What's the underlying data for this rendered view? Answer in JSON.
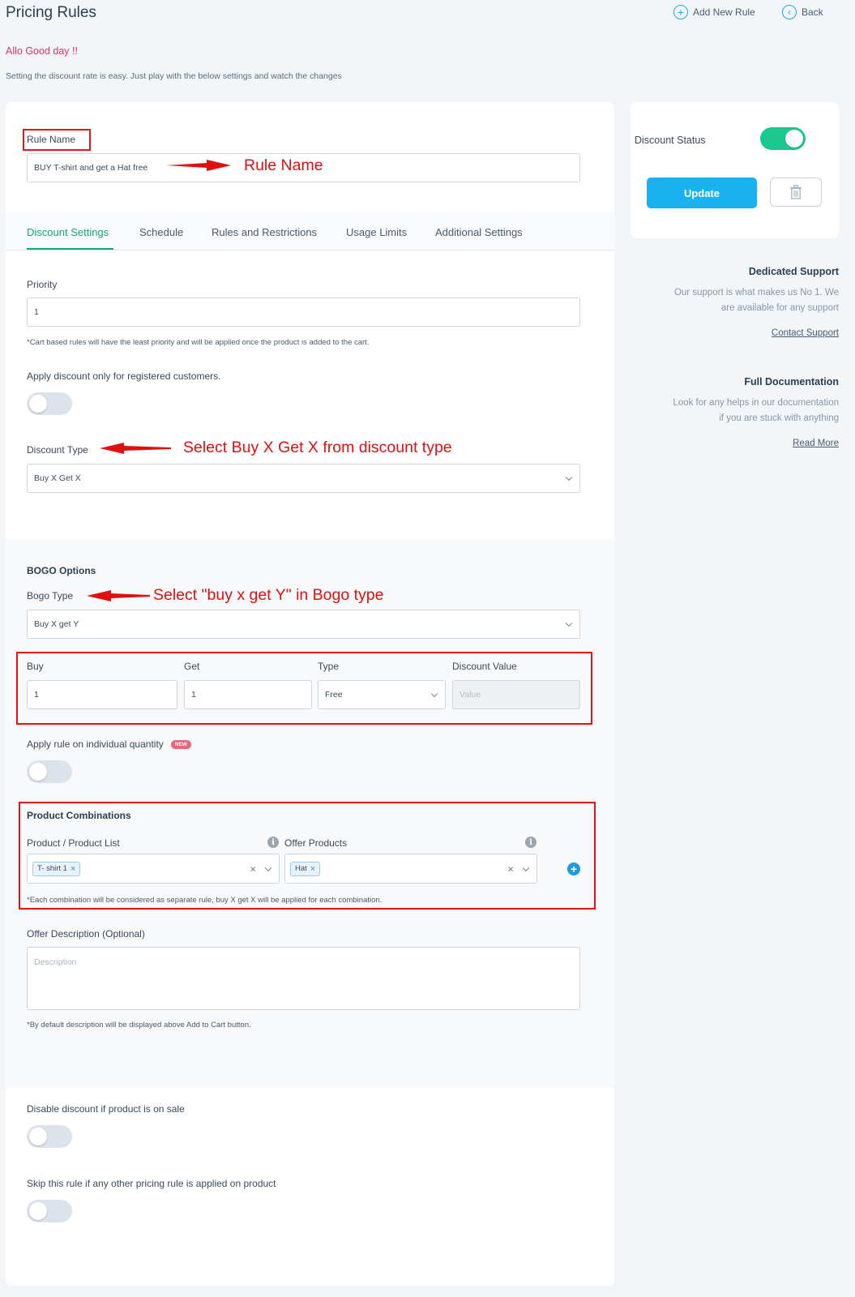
{
  "header": {
    "title": "Pricing Rules",
    "add_new_rule": "Add New Rule",
    "back": "Back",
    "greeting": "Allo Good day !!",
    "intro": "Setting the discount rate is easy. Just play with the below settings and watch the changes"
  },
  "rule_name": {
    "label": "Rule Name",
    "value": "BUY T-shirt and get a Hat free"
  },
  "tabs": [
    {
      "label": "Discount Settings",
      "active": true
    },
    {
      "label": "Schedule",
      "active": false
    },
    {
      "label": "Rules and Restrictions",
      "active": false
    },
    {
      "label": "Usage Limits",
      "active": false
    },
    {
      "label": "Additional Settings",
      "active": false
    }
  ],
  "priority": {
    "label": "Priority",
    "value": "1",
    "note": "*Cart based rules will have the least priority and will be applied once the product is added to the cart."
  },
  "registered_only": {
    "label": "Apply discount only for registered customers.",
    "enabled": false
  },
  "discount_type": {
    "label": "Discount Type",
    "value": "Buy X Get X"
  },
  "bogo": {
    "heading": "BOGO Options",
    "type_label": "Bogo Type",
    "type_value": "Buy X get Y",
    "buy_label": "Buy",
    "buy_value": "1",
    "get_label": "Get",
    "get_value": "1",
    "type_col_label": "Type",
    "type_col_value": "Free",
    "discount_value_label": "Discount Value",
    "discount_value_placeholder": "Value"
  },
  "individual_quantity": {
    "label": "Apply rule on individual quantity",
    "badge": "NEW",
    "enabled": false
  },
  "product_combinations": {
    "heading": "Product Combinations",
    "product_list_label": "Product / Product List",
    "offer_products_label": "Offer Products",
    "product_tags": [
      "T- shirt 1"
    ],
    "offer_tags": [
      "Hat"
    ],
    "note": "*Each combination will be considered as separate rule, buy X get X will be applied for each combination."
  },
  "offer_description": {
    "label": "Offer Description (Optional)",
    "placeholder": "Description",
    "note": "*By default description will be displayed above Add to Cart button."
  },
  "disable_on_sale": {
    "label": "Disable discount if product is on sale",
    "enabled": false
  },
  "skip_rule": {
    "label": "Skip this rule if any other pricing rule is applied on product",
    "enabled": false
  },
  "sidebar": {
    "discount_status_label": "Discount Status",
    "discount_status_enabled": true,
    "update_label": "Update",
    "support_title": "Dedicated Support",
    "support_text_1": "Our support is what makes us No 1. We",
    "support_text_2": "are available for any support",
    "support_link": "Contact Support",
    "docs_title": "Full Documentation",
    "docs_text_1": "Look for any helps in our documentation",
    "docs_text_2": "if you are stuck with anything",
    "docs_link": "Read More"
  },
  "annotations": {
    "rule_name": "Rule Name",
    "discount_type": "Select Buy X Get X from discount type",
    "bogo_type": "Select \"buy x get Y\" in Bogo type"
  },
  "colors": {
    "accent_green": "#17a57a",
    "update_blue": "#1ab1f0",
    "annotation_red": "#e01010",
    "greeting_pink": "#e5315f"
  }
}
